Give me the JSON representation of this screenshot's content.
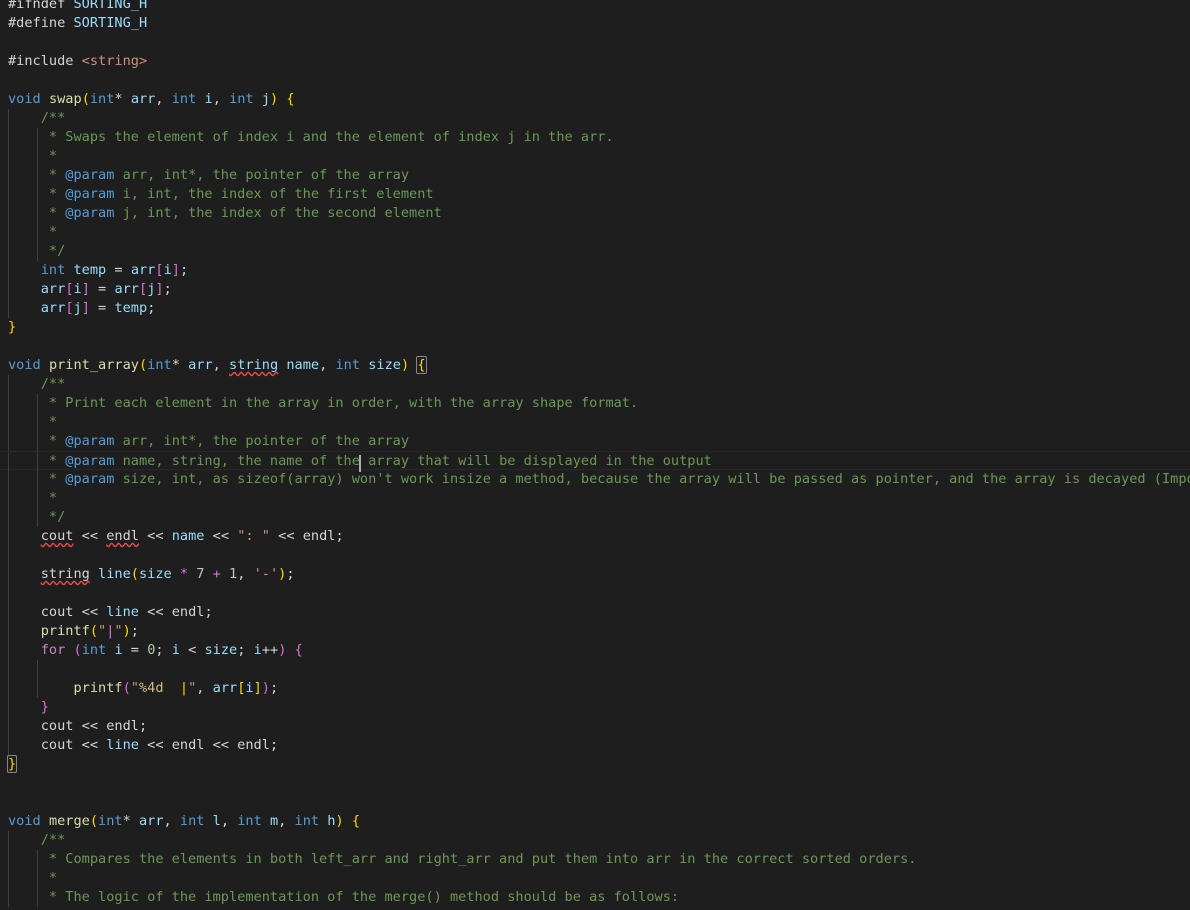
{
  "app": {
    "kind": "code-editor",
    "language": "C++",
    "theme": "Dark+",
    "background": "#1e1e1e",
    "foreground": "#d4d4d4",
    "font_size_px": 13.6,
    "line_height_px": 19
  },
  "colors": {
    "keyword": "#569cd6",
    "control": "#c586c0",
    "function": "#dcdcaa",
    "variable": "#9cdcfe",
    "number": "#b5cea8",
    "string": "#ce9178",
    "format_specifier": "#d7ba7d",
    "comment": "#6a9955",
    "doc_tag": "#569cd6",
    "bracket_level_1": "#ffd700",
    "bracket_level_2": "#da70d6",
    "bracket_level_3": "#179fff",
    "error_squiggle": "#f14c4c",
    "indent_guide": "#404040",
    "caret": "#aeafad",
    "active_line_border": "#282828",
    "bracket_match_border": "#888888"
  },
  "cursor": {
    "line_index": 24,
    "after_text": "the",
    "description": "text caret placed after the word 'the' in the @param name doc line"
  },
  "diagnostics": [
    {
      "token": "string",
      "line_index": 18,
      "kind": "error-squiggle"
    },
    {
      "token": "cout",
      "line_index": 26,
      "kind": "error-squiggle"
    },
    {
      "token": "endl",
      "line_index": 26,
      "kind": "error-squiggle"
    },
    {
      "token": "string",
      "line_index": 28,
      "kind": "error-squiggle"
    }
  ],
  "bracket_matches": [
    {
      "line_index": 18,
      "token": "{",
      "role": "open"
    },
    {
      "line_index": 39,
      "token": "}",
      "role": "close"
    }
  ],
  "code": {
    "lines": [
      "#ifndef SORTING_H",
      "#define SORTING_H",
      "",
      "#include <string>",
      "",
      "void swap(int* arr, int i, int j) {",
      "    /**",
      "     * Swaps the element of index i and the element of index j in the arr.",
      "     *",
      "     * @param arr, int*, the pointer of the array",
      "     * @param i, int, the index of the first element",
      "     * @param j, int, the index of the second element",
      "     *",
      "     */",
      "    int temp = arr[i];",
      "    arr[i] = arr[j];",
      "    arr[j] = temp;",
      "}",
      "",
      "void print_array(int* arr, string name, int size) {",
      "    /**",
      "     * Print each element in the array in order, with the array shape format.",
      "     *",
      "     * @param arr, int*, the pointer of the array",
      "     * @param name, string, the name of the array that will be displayed in the output",
      "     * @param size, int, as sizeof(array) won't work insize a method, because the array will be passed as pointer, and the array is decayed (Important!)",
      "     *",
      "     */",
      "    cout << endl << name << \": \" << endl;",
      "",
      "    string line(size * 7 + 1, '-');",
      "",
      "    cout << line << endl;",
      "    printf(\"|\");",
      "    for (int i = 0; i < size; i++) {",
      "",
      "        printf(\"%4d  |\", arr[i]);",
      "    }",
      "    cout << endl;",
      "    cout << line << endl << endl;",
      "}",
      "",
      "",
      "void merge(int* arr, int l, int m, int h) {",
      "    /**",
      "     * Compares the elements in both left_arr and right_arr and put them into arr in the correct sorted orders.",
      "     *",
      "     * The logic of the implementation of the merge() method should be as follows:"
    ],
    "header_guard": "SORTING_H",
    "include": "<string>",
    "functions": [
      {
        "name": "swap",
        "signature": "void swap(int* arr, int i, int j)"
      },
      {
        "name": "print_array",
        "signature": "void print_array(int* arr, string name, int size)"
      },
      {
        "name": "merge",
        "signature": "void merge(int* arr, int l, int m, int h)"
      }
    ]
  }
}
